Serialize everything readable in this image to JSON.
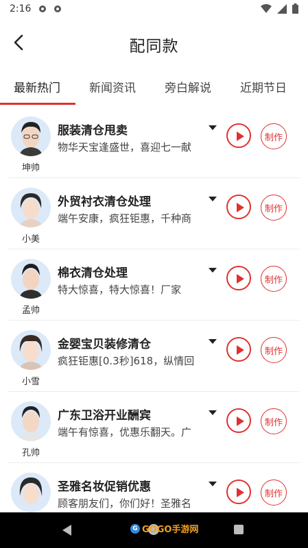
{
  "status_bar": {
    "time": "2:16"
  },
  "header": {
    "title": "配同款"
  },
  "tabs": [
    {
      "label": "最新热门",
      "active": true
    },
    {
      "label": "新闻资讯",
      "active": false
    },
    {
      "label": "旁白解说",
      "active": false
    },
    {
      "label": "近期节日",
      "active": false
    }
  ],
  "items": [
    {
      "title": "服装清仓甩卖",
      "desc": "物华天宝逢盛世，喜迎七一献",
      "voice": "坤帅"
    },
    {
      "title": "外贸衬衣清仓处理",
      "desc": "端午安康，疯狂钜惠，千种商",
      "voice": "小美"
    },
    {
      "title": "棉衣清仓处理",
      "desc": "特大惊喜，特大惊喜！厂家",
      "voice": "孟帅"
    },
    {
      "title": "金婴宝贝装修清仓",
      "desc": "疯狂钜惠[0.3秒]618，纵情回",
      "voice": "小雪"
    },
    {
      "title": "广东卫浴开业酬宾",
      "desc": "端午有惊喜，优惠乐翻天。广",
      "voice": "孔帅"
    },
    {
      "title": "圣雅名妆促销优惠",
      "desc": "顾客朋友们，你们好！圣雅名",
      "voice": ""
    }
  ],
  "make_label": "制作",
  "watermark": {
    "text": "GOGO手游网"
  },
  "colors": {
    "accent": "#e03030",
    "avatar_bg": "#dbe9f8"
  }
}
